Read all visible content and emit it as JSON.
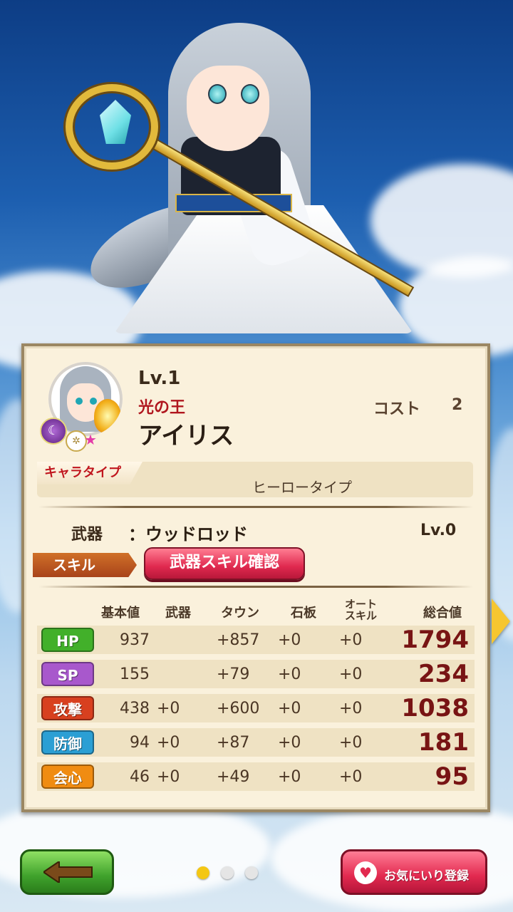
{
  "character": {
    "level": "Lv.1",
    "title": "光の王",
    "name": "アイリス",
    "cost_label": "コスト",
    "cost_value": "2",
    "element_icon": "dark-moon-icon",
    "rarity_icon": "white-emblem-icon"
  },
  "chara_type": {
    "label": "キャラタイプ",
    "value": "ヒーロータイプ"
  },
  "weapon": {
    "label": "武器",
    "separator": "：",
    "name": "ウッドロッド",
    "level": "Lv.0"
  },
  "skill": {
    "label": "スキル",
    "button_label": "武器スキル確認"
  },
  "stats": {
    "headers": [
      "基本値",
      "武器",
      "タウン",
      "石板",
      "オート\nスキル",
      "総合値"
    ],
    "rows": [
      {
        "stat": "HP",
        "base": "937",
        "weapon": "",
        "town": "+857",
        "slate": "+0",
        "auto": "+0",
        "total": "1794",
        "color": "#42b02a"
      },
      {
        "stat": "SP",
        "base": "155",
        "weapon": "",
        "town": "+79",
        "slate": "+0",
        "auto": "+0",
        "total": "234",
        "color": "#a858cc"
      },
      {
        "stat": "攻撃",
        "base": "438",
        "weapon": "+0",
        "town": "+600",
        "slate": "+0",
        "auto": "+0",
        "total": "1038",
        "color": "#d8401f"
      },
      {
        "stat": "防御",
        "base": "94",
        "weapon": "+0",
        "town": "+87",
        "slate": "+0",
        "auto": "+0",
        "total": "181",
        "color": "#2b9fd4"
      },
      {
        "stat": "会心",
        "base": "46",
        "weapon": "+0",
        "town": "+49",
        "slate": "+0",
        "auto": "+0",
        "total": "95",
        "color": "#f08c12"
      }
    ]
  },
  "footer": {
    "back_icon": "back-arrow-icon",
    "favorite_label": "お気にいり登録",
    "favorite_icon": "heart-lock-icon",
    "page_count": 3,
    "page_current": 1
  },
  "nav": {
    "next_icon": "next-arrow-icon"
  }
}
